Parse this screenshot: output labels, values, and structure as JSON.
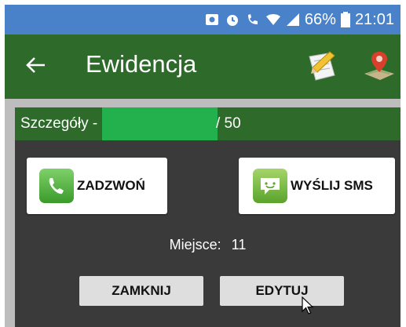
{
  "statusbar": {
    "battery": "66%",
    "time": "21:01"
  },
  "appbar": {
    "back_icon": "arrow-left-icon",
    "title": "Ewidencja",
    "actions": [
      "edit-note-icon",
      "map-pin-icon"
    ]
  },
  "dialog": {
    "header_prefix": "Szczegóły -",
    "header_suffix": "/ 50",
    "call_button": "ZADZWOŃ",
    "sms_button": "WYŚLIJ SMS",
    "place_label": "Miejsce:",
    "place_value": "11",
    "close_button": "ZAMKNIJ",
    "edit_button": "EDYTUJ"
  },
  "colors": {
    "statusbar": "#4a82c9",
    "appbar": "#2e6b2a",
    "dialog_bg": "#3a3a3a",
    "redaction": "#22b14c"
  }
}
